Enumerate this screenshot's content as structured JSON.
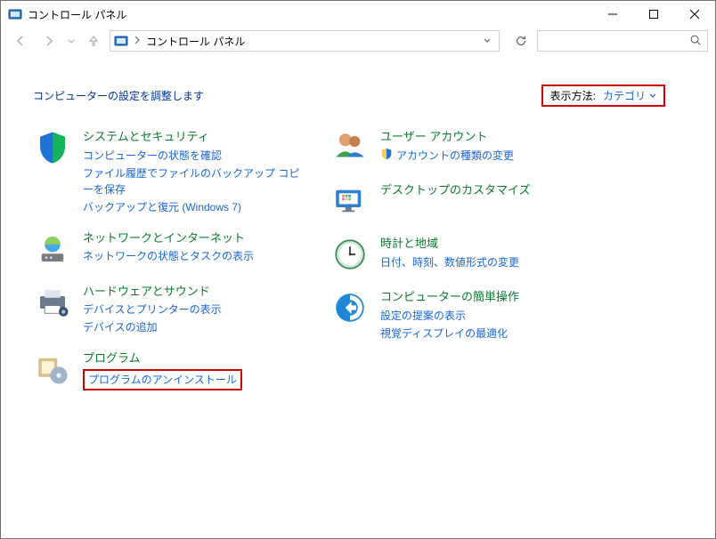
{
  "window": {
    "title": "コントロール パネル"
  },
  "nav": {
    "location": "コントロール パネル",
    "searchPlaceholder": ""
  },
  "header": {
    "adjust": "コンピューターの設定を調整します",
    "viewLabel": "表示方法:",
    "viewValue": "カテゴリ"
  },
  "left": {
    "system": {
      "title": "システムとセキュリティ",
      "links": [
        "コンピューターの状態を確認",
        "ファイル履歴でファイルのバックアップ コピーを保存",
        "バックアップと復元 (Windows 7)"
      ]
    },
    "network": {
      "title": "ネットワークとインターネット",
      "links": [
        "ネットワークの状態とタスクの表示"
      ]
    },
    "hardware": {
      "title": "ハードウェアとサウンド",
      "links": [
        "デバイスとプリンターの表示",
        "デバイスの追加"
      ]
    },
    "programs": {
      "title": "プログラム",
      "links": [
        "プログラムのアンインストール"
      ]
    }
  },
  "right": {
    "user": {
      "title": "ユーザー アカウント",
      "links": [
        "アカウントの種類の変更"
      ]
    },
    "appearance": {
      "title": "デスクトップのカスタマイズ"
    },
    "clock": {
      "title": "時計と地域",
      "links": [
        "日付、時刻、数値形式の変更"
      ]
    },
    "ease": {
      "title": "コンピューターの簡単操作",
      "links": [
        "設定の提案の表示",
        "視覚ディスプレイの最適化"
      ]
    }
  }
}
